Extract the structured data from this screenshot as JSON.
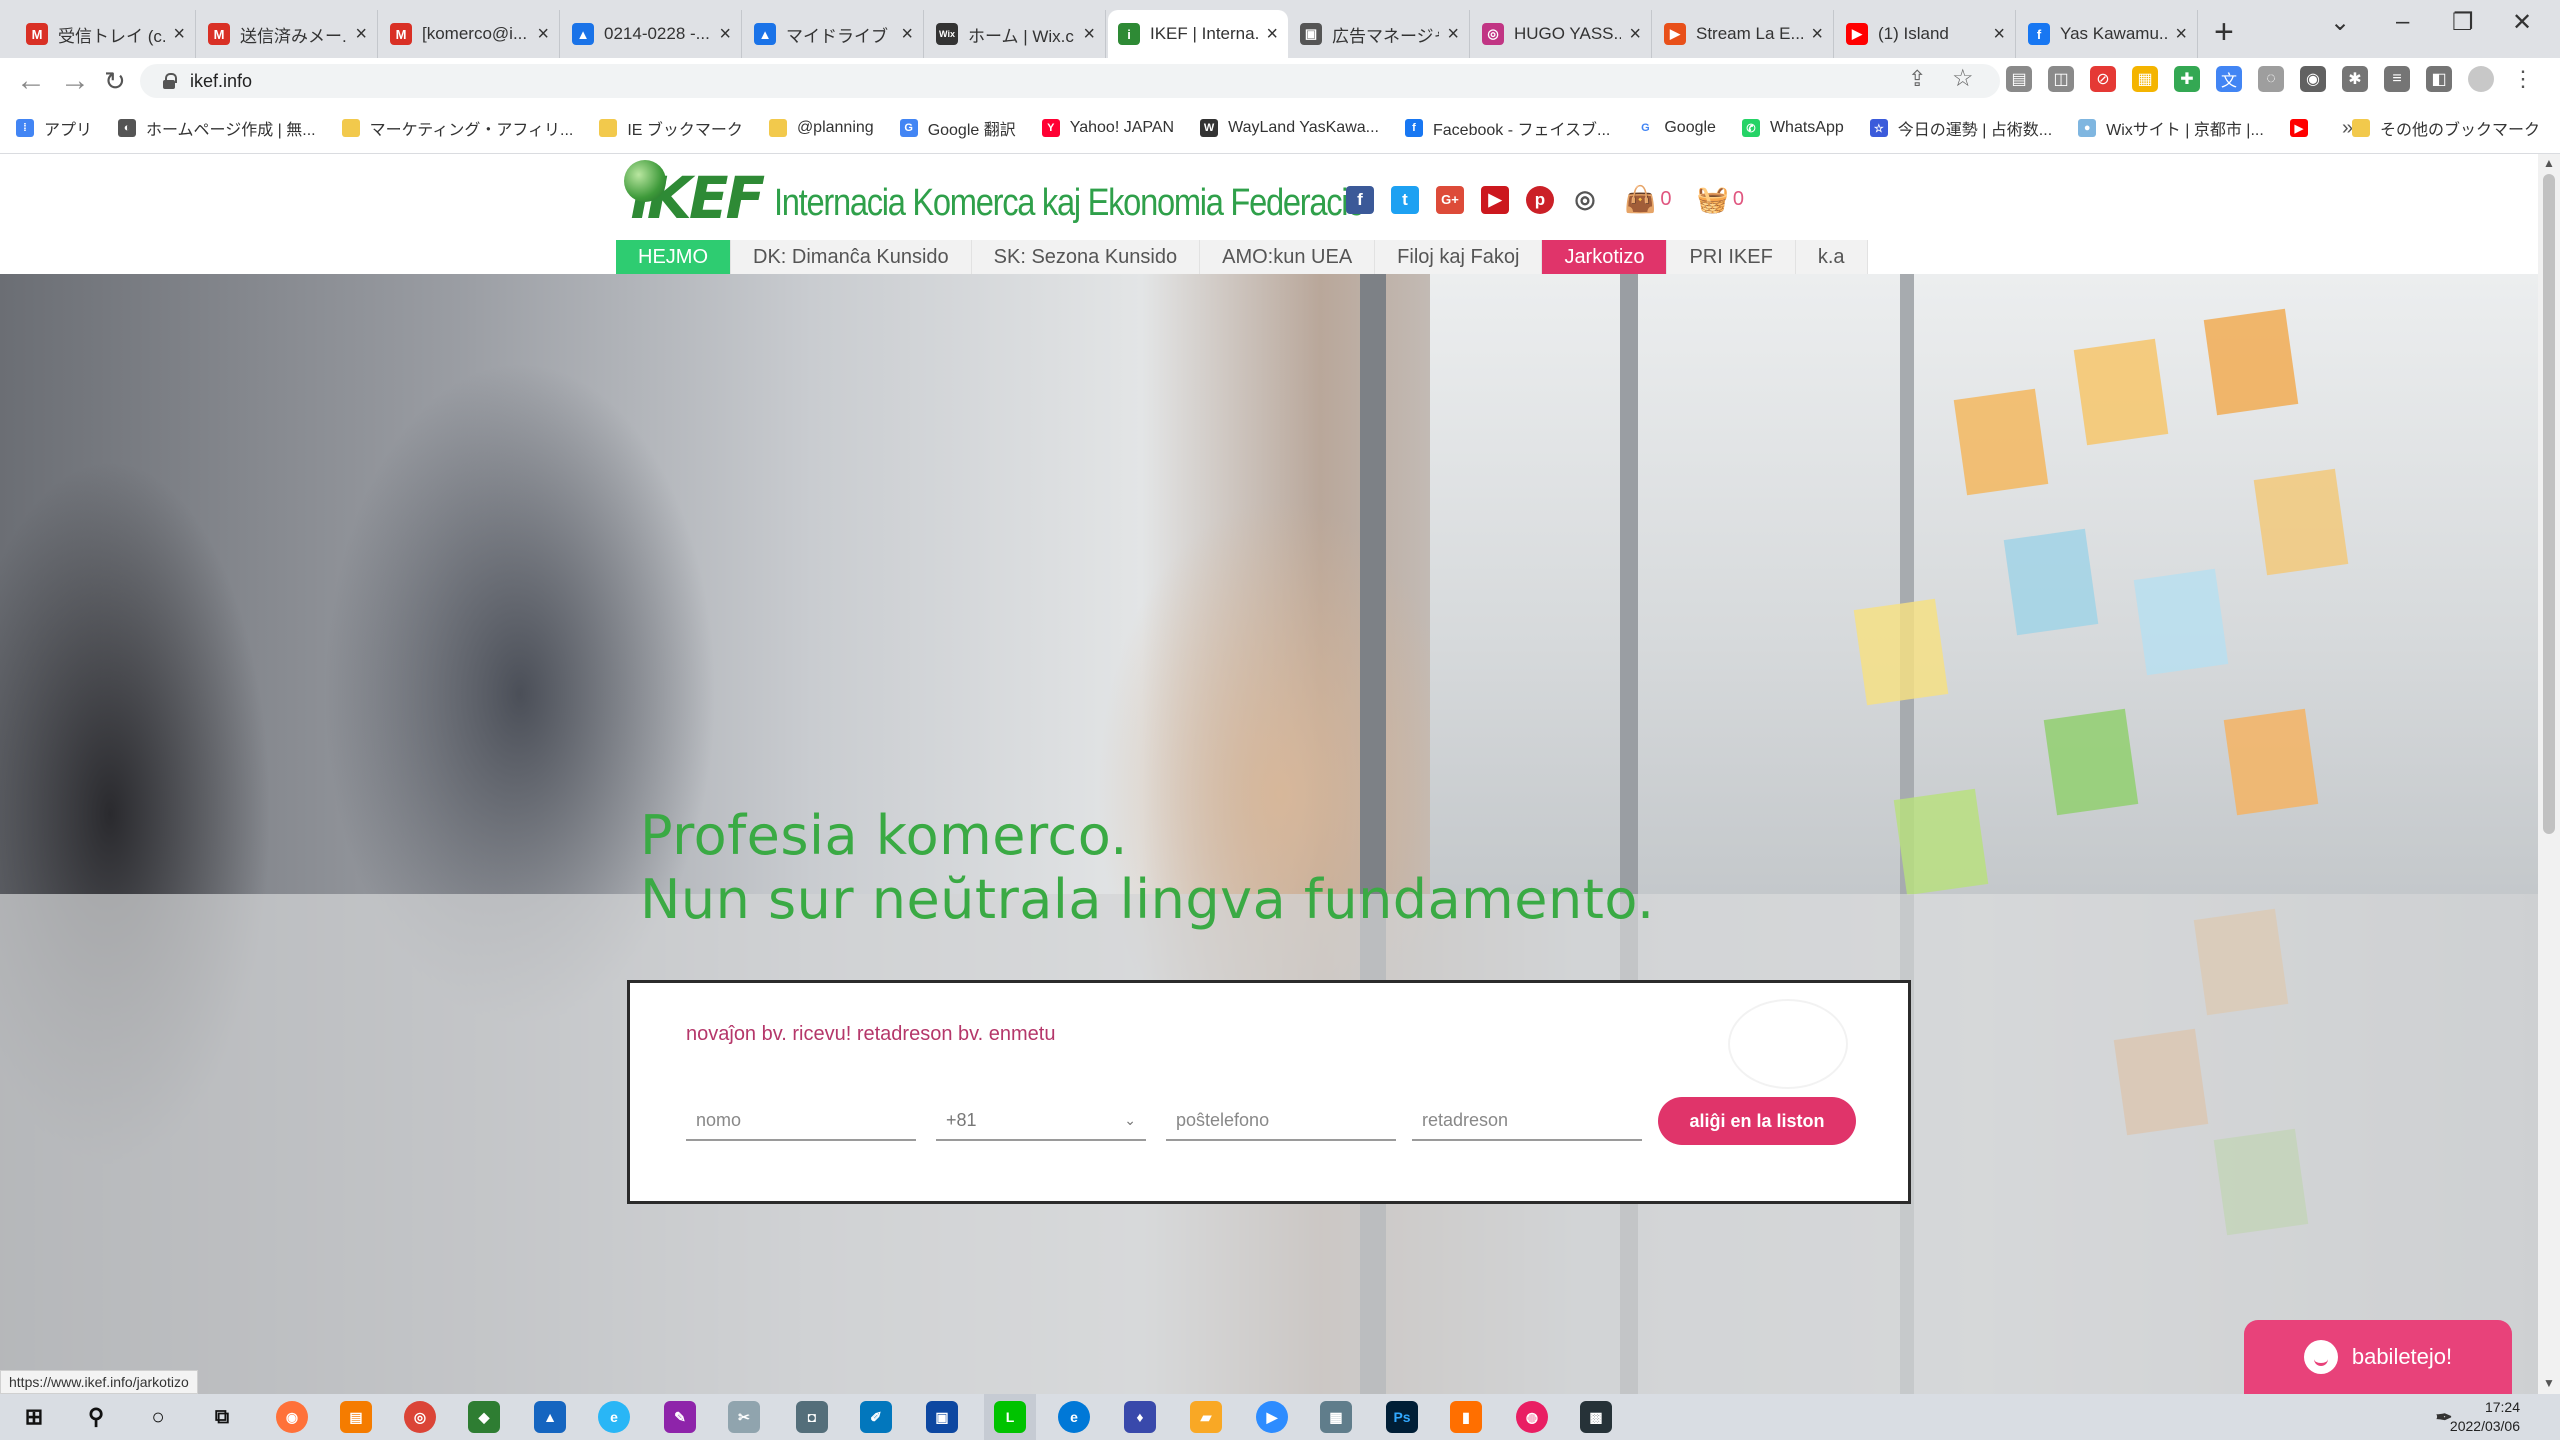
{
  "browser": {
    "tabs": [
      {
        "title": "受信トレイ (c...",
        "favicon": "M",
        "color": "#d93025"
      },
      {
        "title": "送信済みメー...",
        "favicon": "M",
        "color": "#d93025"
      },
      {
        "title": "[komerco@i...",
        "favicon": "M",
        "color": "#d93025"
      },
      {
        "title": "0214-0228 -...",
        "favicon": "▲",
        "color": "#1a73e8"
      },
      {
        "title": "マイドライブ -...",
        "favicon": "▲",
        "color": "#1a73e8"
      },
      {
        "title": "ホーム | Wix.c...",
        "favicon": "Wix",
        "color": "#333333"
      },
      {
        "title": "IKEF | Interna...",
        "favicon": "i",
        "color": "#2e8a35",
        "active": true
      },
      {
        "title": "広告マネージャ...",
        "favicon": "▣",
        "color": "#555555"
      },
      {
        "title": "HUGO YASS...",
        "favicon": "◎",
        "color": "#c13584"
      },
      {
        "title": "Stream La E...",
        "favicon": "▶",
        "color": "#e8501a"
      },
      {
        "title": "(1) Island",
        "favicon": "▶",
        "color": "#ff0000"
      },
      {
        "title": "Yas Kawamu...",
        "favicon": "f",
        "color": "#1877f2"
      }
    ],
    "new_tab": "+",
    "url": "ikef.info",
    "bookmarks": [
      {
        "label": "アプリ",
        "color": "#4285f4",
        "glyph": "⁞"
      },
      {
        "label": "ホームページ作成 | 無...",
        "color": "#555555",
        "glyph": "◐"
      },
      {
        "label": "マーケティング・アフィリ...",
        "color": "#f2c94c",
        "glyph": ""
      },
      {
        "label": "IE ブックマーク",
        "color": "#f2c94c",
        "glyph": ""
      },
      {
        "label": "@planning",
        "color": "#f2c94c",
        "glyph": ""
      },
      {
        "label": "Google 翻訳",
        "color": "#4285f4",
        "glyph": "G"
      },
      {
        "label": "Yahoo! JAPAN",
        "color": "#ff0033",
        "glyph": "Y"
      },
      {
        "label": "WayLand YasKawa...",
        "color": "#333333",
        "glyph": "W"
      },
      {
        "label": "Facebook - フェイスブ...",
        "color": "#1877f2",
        "glyph": "f"
      },
      {
        "label": "Google",
        "color": "#ffffff",
        "glyph": "G"
      },
      {
        "label": "WhatsApp",
        "color": "#25d366",
        "glyph": "✆"
      },
      {
        "label": "今日の運勢 | 占術数...",
        "color": "#3b5bdb",
        "glyph": "☆"
      },
      {
        "label": "Wixサイト | 京都市 |...",
        "color": "#7fb6e0",
        "glyph": "●"
      },
      {
        "label": "",
        "color": "#ff0000",
        "glyph": "▶"
      }
    ],
    "bookmarks_more": "»",
    "other_bookmarks": "その他のブックマーク",
    "status_url": "https://www.ikef.info/jarkotizo"
  },
  "site": {
    "logo_mark": "iKEF",
    "logo_text": "Internacia Komerca kaj Ekonomia Federacio",
    "cart1_count": "0",
    "cart2_count": "0",
    "nav": [
      {
        "label": "HEJMO",
        "style": "home"
      },
      {
        "label": "DK: Dimanĉa Kunsido",
        "style": ""
      },
      {
        "label": "SK: Sezona Kunsido",
        "style": ""
      },
      {
        "label": "AMO:kun UEA",
        "style": ""
      },
      {
        "label": "Filoj kaj Fakoj",
        "style": ""
      },
      {
        "label": "Jarkotizo",
        "style": "hot"
      },
      {
        "label": "PRI IKEF",
        "style": ""
      },
      {
        "label": "k.a",
        "style": ""
      }
    ],
    "headline_line1": "Profesia komerco.",
    "headline_line2": "Nun sur neŭtrala lingva fundamento.",
    "signup": {
      "intro": "novaĵon bv. ricevu! retadreson bv. enmetu",
      "name_placeholder": "nomo",
      "country_code": "+81",
      "phone_placeholder": "poŝtelefono",
      "email_placeholder": "retadreson",
      "submit_label": "aliĝi en la liston"
    },
    "chat_label": "babiletejo!"
  },
  "taskbar": {
    "time": "17:24",
    "date": "2022/03/06"
  }
}
